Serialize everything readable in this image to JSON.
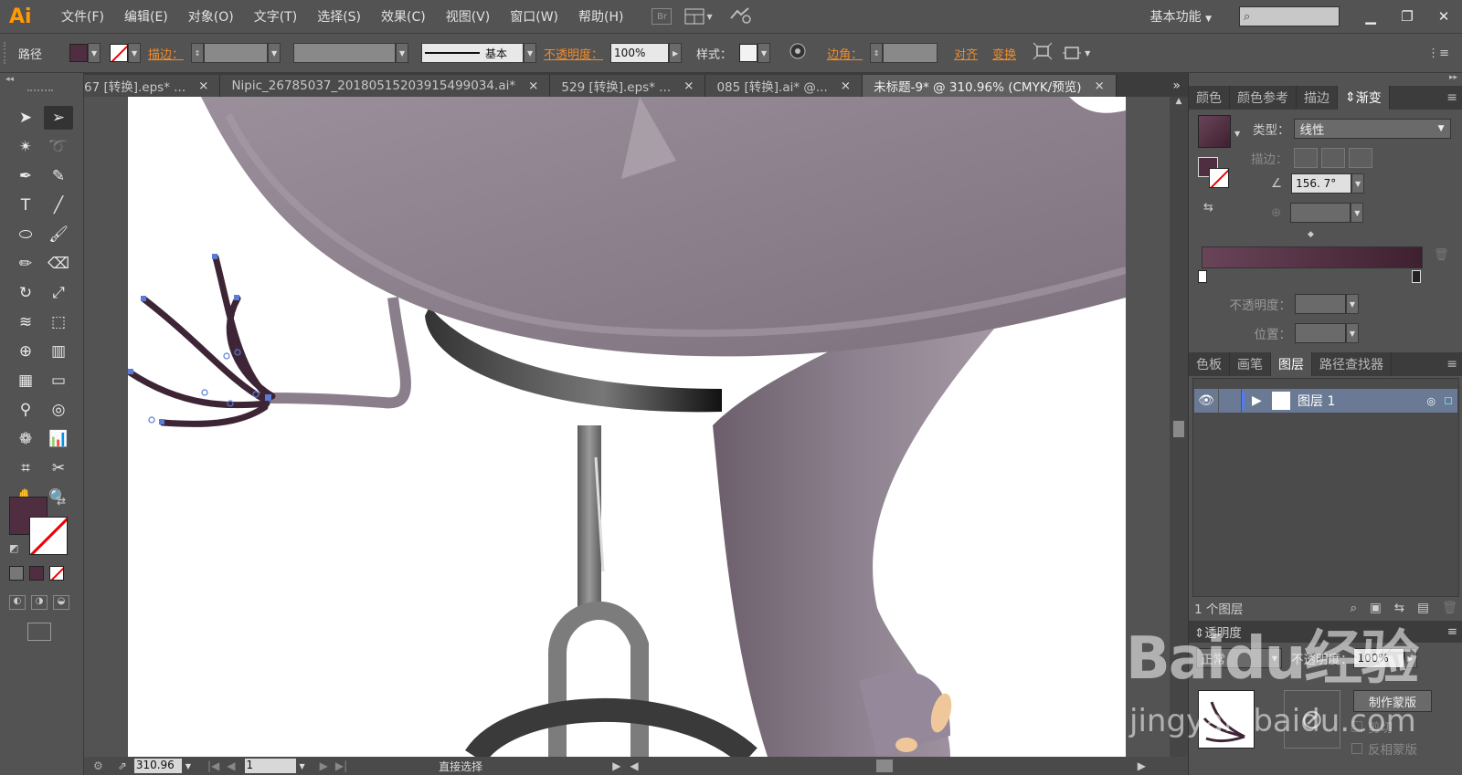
{
  "app": {
    "logo": "Ai"
  },
  "menu": [
    "文件(F)",
    "编辑(E)",
    "对象(O)",
    "文字(T)",
    "选择(S)",
    "效果(C)",
    "视图(V)",
    "窗口(W)",
    "帮助(H)"
  ],
  "menubar": {
    "bridge_icon": "Br",
    "workspace": "基本功能",
    "minimize": "▁",
    "restore": "❐",
    "close": "✕"
  },
  "control": {
    "object_type": "路径",
    "stroke_label": "描边：",
    "stroke_style": "基本",
    "opacity_label": "不透明度：",
    "opacity_value": "100%",
    "style_label": "样式：",
    "corner_label": "边角：",
    "align_label": "对齐",
    "transform_label": "变换"
  },
  "tabs": [
    {
      "label": "67 [转换].eps* ...",
      "active": false
    },
    {
      "label": "Nipic_26785037_20180515203915499034.ai*",
      "active": false
    },
    {
      "label": "529 [转换].eps* ...",
      "active": false
    },
    {
      "label": "085 [转换].ai* @...",
      "active": false
    },
    {
      "label": "未标题-9* @ 310.96% (CMYK/预览)",
      "active": true
    }
  ],
  "tab_close": "×",
  "tab_overflow": "»",
  "status": {
    "zoom": "310.96",
    "page": "1",
    "tool": "直接选择"
  },
  "gradient_panel": {
    "tabs": [
      "颜色",
      "颜色参考",
      "描边",
      "渐变"
    ],
    "type_label": "类型：",
    "type_value": "线性",
    "stroke_label": "描边：",
    "angle_value": "156. 7°",
    "opacity_label": "不透明度：",
    "position_label": "位置：",
    "start_color": "#6a4458",
    "end_color": "#3e2030"
  },
  "layers_panel": {
    "tabs": [
      "色板",
      "画笔",
      "图层",
      "路径查找器"
    ],
    "layer_name": "图层 1",
    "count": "1 个图层"
  },
  "transparency_panel": {
    "title": "透明度",
    "blend": "正常",
    "opacity_label": "不透明度：",
    "opacity_value": "100%",
    "make_mask": "制作蒙版",
    "clip": "剪切",
    "invert": "反相蒙版"
  },
  "watermark": {
    "line1": "Baidu经验",
    "line2": "jingyan.baidu.com"
  },
  "colors": {
    "fill": "#4e2e40",
    "accent": "#f28c28"
  }
}
